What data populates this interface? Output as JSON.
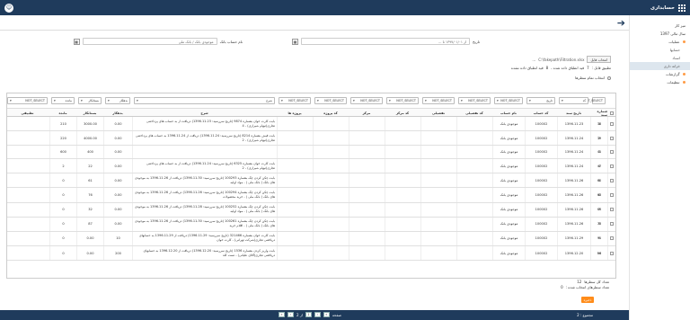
{
  "app": {
    "title": "حسابداری",
    "user_initial": "☺"
  },
  "sidebar": {
    "items": [
      {
        "label": "میز کار",
        "dot": false,
        "sub": false
      },
      {
        "label": "سال مالی 1397",
        "dot": false,
        "sub": false
      },
      {
        "label": "عملیات",
        "dot": true,
        "sub": false
      },
      {
        "label": "حسابها",
        "dot": false,
        "sub": true
      },
      {
        "label": "اسناد",
        "dot": false,
        "sub": true
      },
      {
        "label": "خزانه داری",
        "dot": false,
        "sub": true,
        "active": true
      },
      {
        "label": "گزارشات",
        "dot": true,
        "sub": false
      },
      {
        "label": "تنظیمات",
        "dot": true,
        "sub": false
      }
    ]
  },
  "filter": {
    "date_label": "تاریخ",
    "date_value": "از ۱۳۹۷/۰۱/۰۱ تا ...",
    "account_label": "نام حساب بانک",
    "account_placeholder": "موجودی بانک / بانک ملی",
    "file_button": "انتخاب فایل",
    "file_path": "C:\\fakepath\\Filtration.xlsx",
    "file_note": "...",
    "summary_total_label": "تطبیق قابل :",
    "summary_total_value": "7",
    "summary_total_unit": "قید انطباق داده شده ،",
    "summary_count_value": "8",
    "summary_count_unit": "قید انطباق داده نشده",
    "select_all_label": "انتخاب تمام سطرها"
  },
  "table": {
    "filters": [
      "NOT_SELECT",
      "کد",
      "تاریخ",
      "NOT_SELECT",
      "NOT_SELECT",
      "NOT_SELECT",
      "NOT_SELECT",
      "NOT_SELECT",
      "NOT_SELECT",
      "NOT_SELECT",
      "شرح",
      "بدهکار",
      "بستانکار",
      "مانده",
      "NOT_SELECT"
    ],
    "headers": [
      "شماره سند",
      "تاریخ سند",
      "کد حساب",
      "نام حساب",
      "کد تفضیلی",
      "تفضیلی",
      "کد مرکز",
      "مرکز",
      "کد پروژه",
      "پروژه ها",
      "شرح",
      "بدهکار",
      "بستانکار",
      "مانده",
      "تطبیقی"
    ],
    "rows": [
      {
        "no": "38",
        "n": "1",
        "date": "1396.11.23",
        "code": "100002",
        "acc": "موجودی بانک",
        "desc": "بابت کارت خوان بشماره 9874 (تاریخ سررسید: 1396.11.23) دریافت از  به حساب های پرداختنی تجاری(تیهام شیرازی) - 4",
        "deb": "0.00",
        "cred": "3000.00",
        "bal": "210",
        "h": 10
      },
      {
        "no": "39",
        "n": "2",
        "date": "1396.11.24",
        "code": "100002",
        "acc": "موجودی بانک",
        "desc": "بابت فیش بشماره 8214 (تاریخ سررسید: 1396.11.24) دریافت از 1396.11.24 به حساب های پرداختنی تجاری(تیهام شیرازی) - 2",
        "deb": "0.00",
        "cred": "4000.00",
        "bal": "220",
        "h": 10
      },
      {
        "no": "41",
        "n": "3",
        "date": "1396.11.24",
        "code": "100002",
        "acc": "موجودی بانک",
        "desc": "",
        "deb": "0.00",
        "cred": "400",
        "bal": "600",
        "h": 9
      },
      {
        "no": "47",
        "n": "4",
        "date": "1396.11.24",
        "code": "100002",
        "acc": "موجودی بانک",
        "desc": "بابت کارت خوان بشماره 6325 (تاریخ سررسید: 1396.11.24) دریافت از  به حساب های پرداختنی تجاری(تیهام شیرازی) - 2",
        "deb": "0.00",
        "cred": "22",
        "bal": "2",
        "h": 10
      },
      {
        "no": "60",
        "n": "5",
        "date": "1396.11.26",
        "code": "100002",
        "acc": "موجودی بانک",
        "desc": "بابت چکن کردن چک بشماره 100293 (تاریخ سررسید: 1396.11.30) دریافت از 1396.11.26 به موجودی های بانک ( بانک ملی ) - مواد اولیه",
        "deb": "0.00",
        "cred": "61",
        "bal": "0",
        "h": 10
      },
      {
        "no": "63",
        "n": "6",
        "date": "1396.11.26",
        "code": "100002",
        "acc": "موجودی بانک",
        "desc": "بابت چکن کردن چک بشماره 100294 (تاریخ سررسید: 1396.11.26) دریافت از 1396.11.26 به موجودی های بانک ( بانک ملی ) - خرید محصولات",
        "deb": "0.00",
        "cred": "76",
        "bal": "0",
        "h": 10
      },
      {
        "no": "66",
        "n": "7",
        "date": "1396.11.26",
        "code": "100002",
        "acc": "موجودی بانک",
        "desc": "بابت چکن کردن چک بشماره 100252 (تاریخ سررسید: 1396.11.28) دریافت از 1396.11.26 به موجودی های بانک ( بانک ملی ) - مواد اولیه",
        "deb": "0.00",
        "cred": "32",
        "bal": "0",
        "h": 10
      },
      {
        "no": "73",
        "n": "8",
        "date": "1396.11.26",
        "code": "100002",
        "acc": "موجودی بانک",
        "desc": "بابت چکن کردن چک بشماره 100261 (تاریخ سررسید: 1396.11.30) دریافت از 1396.11.26 به موجودی های بانک ( بانک ملی ) - اقلام خرید",
        "deb": "0.00",
        "cred": "87",
        "bal": "0",
        "h": 10
      },
      {
        "no": "91",
        "n": "9",
        "date": "1396.11.29",
        "code": "100002",
        "acc": "موجودی بانک",
        "desc": "بابت کارت خوان بشماره 321466 (تاریخ سررسید: 1396.11.29) دریافت از 1396.11.29 به حسابهای دریافتنی تجاری(شرکت تهرانی) - کارت خوان",
        "deb": "10",
        "cred": "0.00",
        "bal": "0",
        "h": 10
      },
      {
        "no": "96",
        "n": "10",
        "date": "1396.12.20",
        "code": "100002",
        "acc": "موجودی بانک",
        "desc": "بابت واریز کردن بشماره 1536 (تاریخ سررسید: 1396.12.20) دریافت از 1396.12.20 به حسابهای دریافتنی تجاری(آقای علیاتی) - تست کلد",
        "deb": "200",
        "cred": "0.00",
        "bal": "0",
        "h": 10
      }
    ]
  },
  "below": {
    "selected_label": "تعداد کل سطرها",
    "selected_value": "12",
    "matched_label": "تعداد سطرهای انتخاب شده :",
    "matched_value": "0",
    "save_label": "ذخیره"
  },
  "footer": {
    "total_label": "مجموع : 2",
    "page_label": "صفحه",
    "page_current": "1",
    "page_total": "از 2",
    "first": "«",
    "prev": "‹",
    "next": "›",
    "last": "»"
  }
}
